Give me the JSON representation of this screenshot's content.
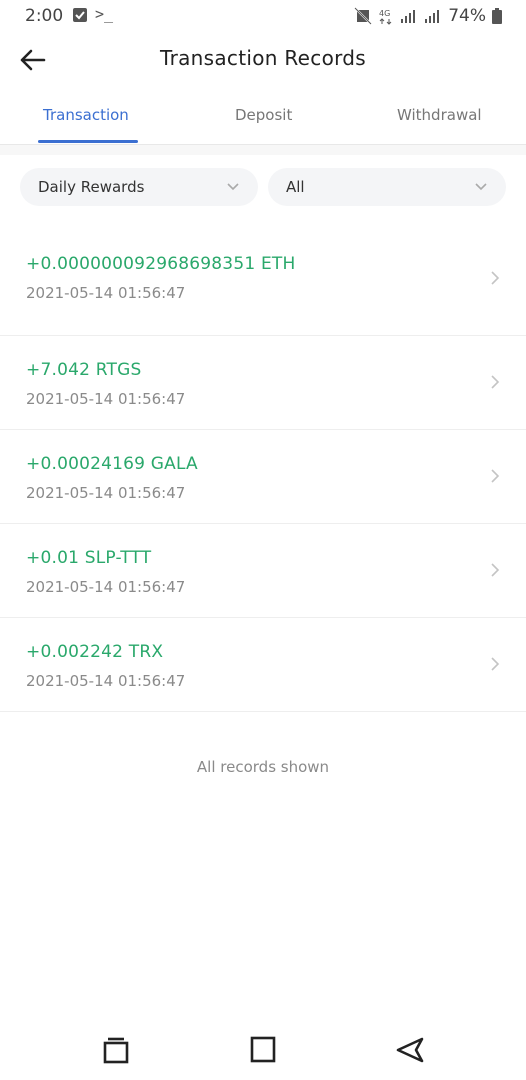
{
  "status_bar": {
    "time": "2:00",
    "battery": "74%",
    "network": "4G"
  },
  "header": {
    "title": "Transaction Records"
  },
  "tabs": [
    {
      "label": "Transaction",
      "active": true
    },
    {
      "label": "Deposit",
      "active": false
    },
    {
      "label": "Withdrawal",
      "active": false
    }
  ],
  "filters": {
    "type": "Daily Rewards",
    "coin": "All"
  },
  "records": [
    {
      "amount": "+0.000000092968698351 ETH",
      "time": "2021-05-14 01:56:47"
    },
    {
      "amount": "+7.042 RTGS",
      "time": "2021-05-14 01:56:47"
    },
    {
      "amount": "+0.00024169 GALA",
      "time": "2021-05-14 01:56:47"
    },
    {
      "amount": "+0.01 SLP-TTT",
      "time": "2021-05-14 01:56:47"
    },
    {
      "amount": "+0.002242 TRX",
      "time": "2021-05-14 01:56:47"
    }
  ],
  "end_note": "All records shown",
  "colors": {
    "accent": "#3b6fd1",
    "positive": "#2aa86b",
    "muted": "#8a8a8a"
  }
}
